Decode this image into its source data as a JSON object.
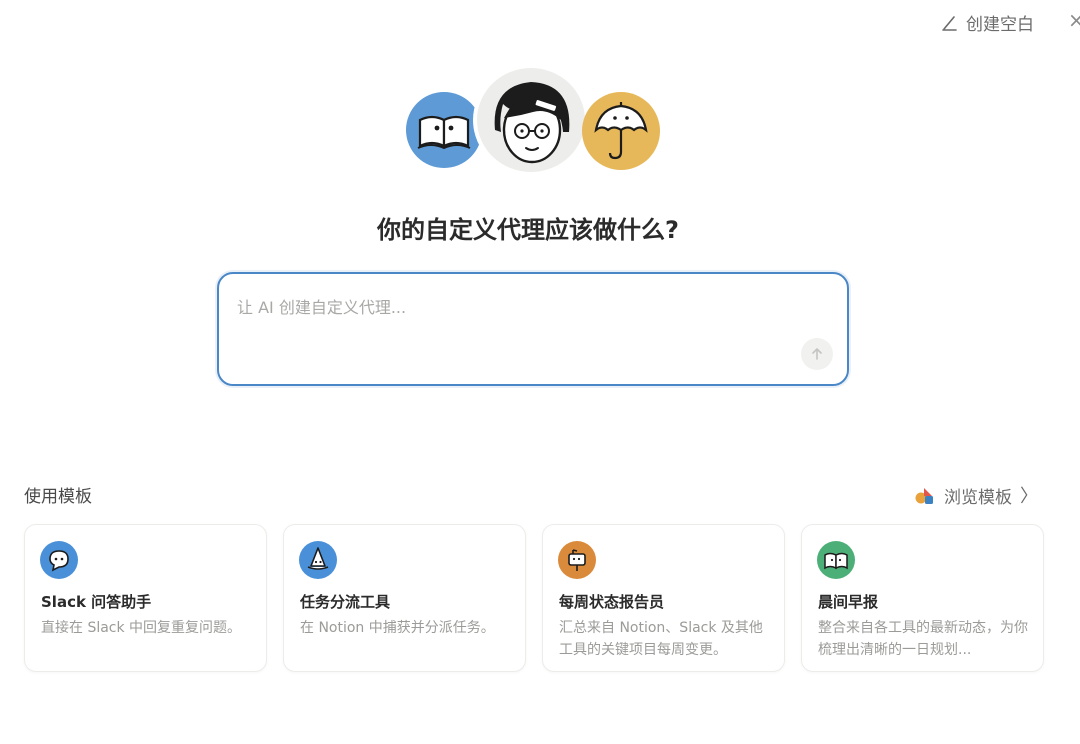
{
  "header": {
    "create_blank_label": "创建空白",
    "close_label": "×"
  },
  "avatars": [
    "book-avatar",
    "face-avatar",
    "umbrella-avatar"
  ],
  "main": {
    "heading": "你的自定义代理应该做什么?",
    "prompt": {
      "placeholder": "让 AI 创建自定义代理...",
      "value": ""
    }
  },
  "templates": {
    "title": "使用模板",
    "browse_label": "浏览模板",
    "browse_chevron": "〉",
    "cards": [
      {
        "icon": "speech-bubble-icon",
        "icon_color": "#4a90d9",
        "title": "Slack 问答助手",
        "description": "直接在 Slack 中回复重复问题。"
      },
      {
        "icon": "witch-hat-icon",
        "icon_color": "#4a90d9",
        "title": "任务分流工具",
        "description": "在 Notion 中捕获并分派任务。"
      },
      {
        "icon": "mailbox-icon",
        "icon_color": "#d98a3a",
        "title": "每周状态报告员",
        "description": "汇总来自 Notion、Slack 及其他工具的关键项目每周变更。"
      },
      {
        "icon": "open-book-icon",
        "icon_color": "#4caf78",
        "title": "晨间早报",
        "description": "整合来自各工具的最新动态，为你梳理出清晰的一日规划..."
      }
    ]
  },
  "colors": {
    "accent": "#4a87c7",
    "text": "#2b2b2b",
    "muted": "#9b9b98"
  }
}
